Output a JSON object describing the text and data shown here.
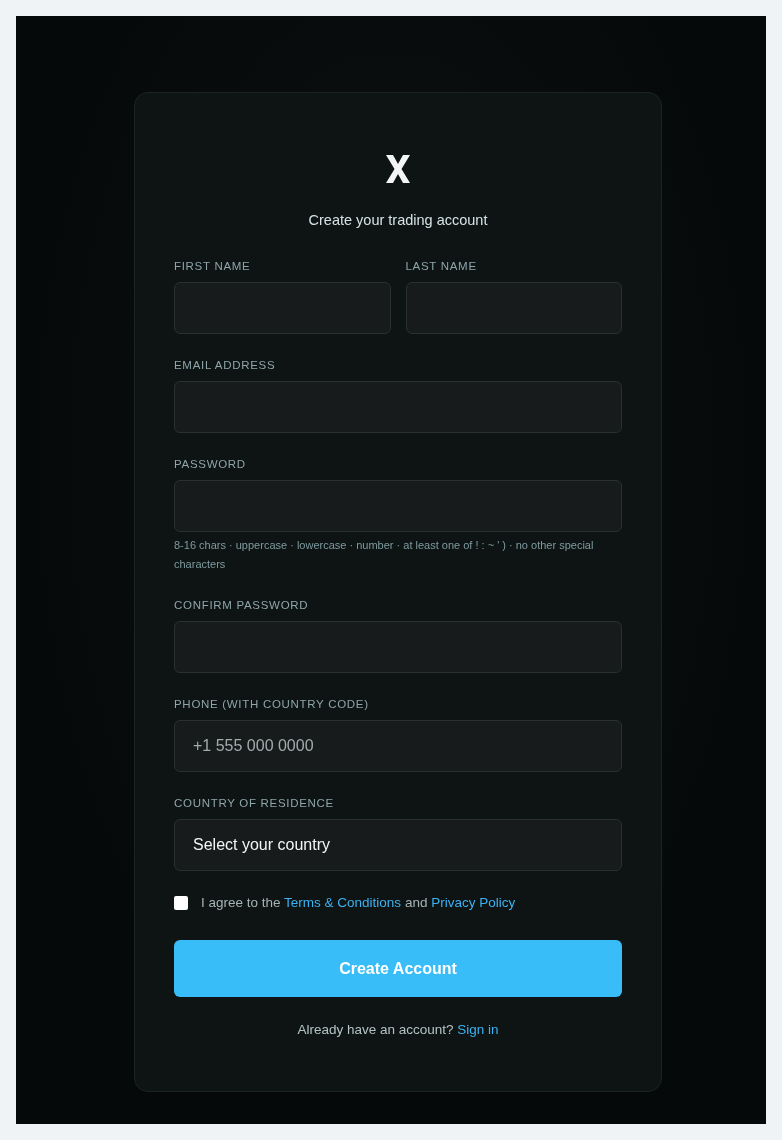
{
  "title": "Create your trading account",
  "rows": [
    {
      "fields": [
        {
          "kind": "input",
          "label": "FIRST NAME"
        },
        {
          "kind": "input",
          "label": "LAST NAME"
        }
      ]
    },
    {
      "fields": [
        {
          "kind": "input",
          "label": "EMAIL ADDRESS"
        }
      ]
    },
    {
      "fields": [
        {
          "kind": "input",
          "label": "PASSWORD",
          "hint": "8-16 chars · uppercase · lowercase · number · at least one of ! : ~ ' ) · no other special characters"
        }
      ]
    },
    {
      "fields": [
        {
          "kind": "input",
          "label": "CONFIRM PASSWORD"
        }
      ]
    },
    {
      "fields": [
        {
          "kind": "input",
          "label": "PHONE (WITH COUNTRY CODE)",
          "placeholder": "+1 555 000 0000"
        }
      ]
    },
    {
      "fields": [
        {
          "kind": "select",
          "label": "COUNTRY OF RESIDENCE",
          "value": "Select your country"
        }
      ]
    }
  ],
  "agreement": {
    "checked": false,
    "parts": [
      {
        "kind": "text",
        "text": "I agree to the"
      },
      {
        "kind": "link",
        "text": "Terms & Conditions"
      },
      {
        "kind": "text",
        "text": "and"
      },
      {
        "kind": "link",
        "text": "Privacy Policy"
      }
    ]
  },
  "submit": {
    "label": "Create Account"
  },
  "signin": {
    "parts": [
      {
        "kind": "text",
        "text": "Already have an account?"
      },
      {
        "kind": "link",
        "text": "Sign in"
      }
    ]
  }
}
